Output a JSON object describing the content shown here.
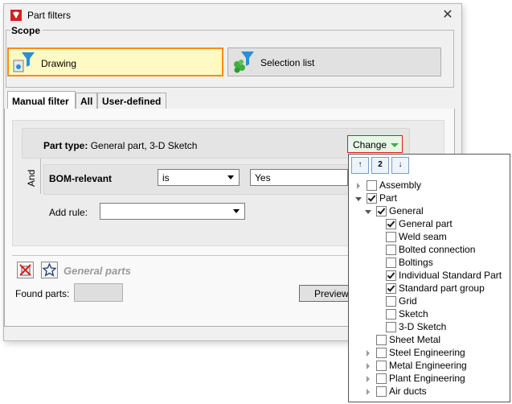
{
  "window": {
    "title": "Part filters",
    "close_glyph": "✕"
  },
  "scope": {
    "title": "Scope",
    "drawing_label": "Drawing",
    "selection_label": "Selection list"
  },
  "tabs": [
    "Manual filter",
    "All",
    "User-defined"
  ],
  "part_type": {
    "label": "Part type:",
    "value": "General part, 3-D Sketch",
    "change_label": "Change"
  },
  "and_label": "And",
  "bom_rule": {
    "label": "BOM-relevant",
    "operator": "is",
    "value": "Yes"
  },
  "add_rule": {
    "label": "Add rule:",
    "value": ""
  },
  "footer": {
    "filter_name": "General parts",
    "found_label": "Found parts:",
    "found_value": "",
    "preview_label": "Preview"
  },
  "popup": {
    "tools": [
      {
        "icon": "sort-ascending-icon",
        "glyph": "↑"
      },
      {
        "icon": "level-2-icon",
        "glyph": "2"
      },
      {
        "icon": "sort-descending-icon",
        "glyph": "↓"
      }
    ],
    "tree": [
      {
        "label": "Assembly",
        "level": 0,
        "toggle": "collapsed",
        "checked": false
      },
      {
        "label": "Part",
        "level": 0,
        "toggle": "expanded",
        "checked": true
      },
      {
        "label": "General",
        "level": 1,
        "toggle": "expanded",
        "checked": true
      },
      {
        "label": "General part",
        "level": 2,
        "toggle": "none",
        "checked": true
      },
      {
        "label": "Weld seam",
        "level": 2,
        "toggle": "none",
        "checked": false
      },
      {
        "label": "Bolted connection",
        "level": 2,
        "toggle": "none",
        "checked": false
      },
      {
        "label": "Boltings",
        "level": 2,
        "toggle": "none",
        "checked": false
      },
      {
        "label": "Individual Standard Part",
        "level": 2,
        "toggle": "none",
        "checked": true
      },
      {
        "label": "Standard part group",
        "level": 2,
        "toggle": "none",
        "checked": true
      },
      {
        "label": "Grid",
        "level": 2,
        "toggle": "none",
        "checked": false
      },
      {
        "label": "Sketch",
        "level": 2,
        "toggle": "none",
        "checked": false
      },
      {
        "label": "3-D Sketch",
        "level": 2,
        "toggle": "none",
        "checked": false
      },
      {
        "label": "Sheet Metal",
        "level": 1,
        "toggle": "none",
        "checked": false
      },
      {
        "label": "Steel Engineering",
        "level": 1,
        "toggle": "collapsed",
        "checked": false
      },
      {
        "label": "Metal Engineering",
        "level": 1,
        "toggle": "collapsed",
        "checked": false
      },
      {
        "label": "Plant Engineering",
        "level": 1,
        "toggle": "collapsed",
        "checked": false
      },
      {
        "label": "Air ducts",
        "level": 1,
        "toggle": "collapsed",
        "checked": false
      }
    ]
  },
  "colors": {
    "highlight_border": "#ff8c00",
    "highlight_fill": "#fff9c4",
    "change_border": "#e01919",
    "change_arrow": "#4aa84a"
  }
}
